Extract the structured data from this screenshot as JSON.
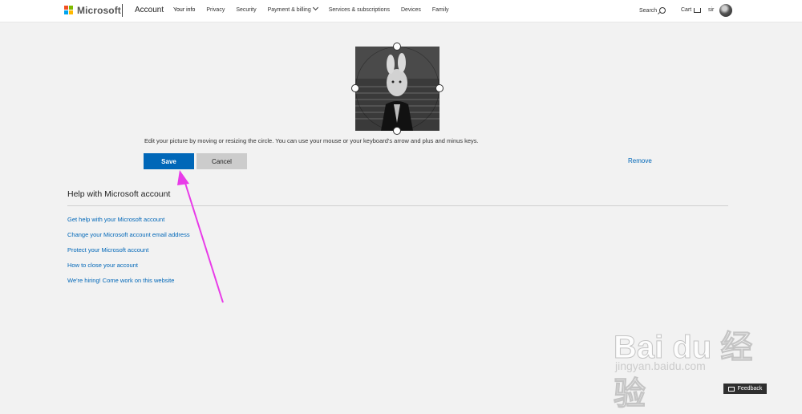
{
  "header": {
    "brand": "Microsoft",
    "section": "Account",
    "nav": [
      "Your info",
      "Privacy",
      "Security",
      "Payment & billing",
      "Services & subscriptions",
      "Devices",
      "Family"
    ],
    "search_label": "Search",
    "cart_label": "Cart",
    "user_name": "sir"
  },
  "editor": {
    "hint": "Edit your picture by moving or resizing the circle. You can use your mouse or your keyboard's arrow and plus and minus keys.",
    "save_label": "Save",
    "cancel_label": "Cancel",
    "remove_label": "Remove"
  },
  "help": {
    "title": "Help with Microsoft account",
    "links": [
      "Get help with your Microsoft account",
      "Change your Microsoft account email address",
      "Protect your Microsoft account",
      "How to close your account",
      "We're hiring! Come work on this website"
    ]
  },
  "watermark": {
    "main": "Bai du 经验",
    "sub": "jingyan.baidu.com"
  },
  "feedback_label": "Feedback",
  "colors": {
    "accent": "#0067b8",
    "annotation": "#e83be8",
    "background": "#f2f2f2"
  },
  "icons": [
    "microsoft-logo-icon",
    "search-icon",
    "cart-icon",
    "chevron-down-icon",
    "feedback-icon"
  ]
}
